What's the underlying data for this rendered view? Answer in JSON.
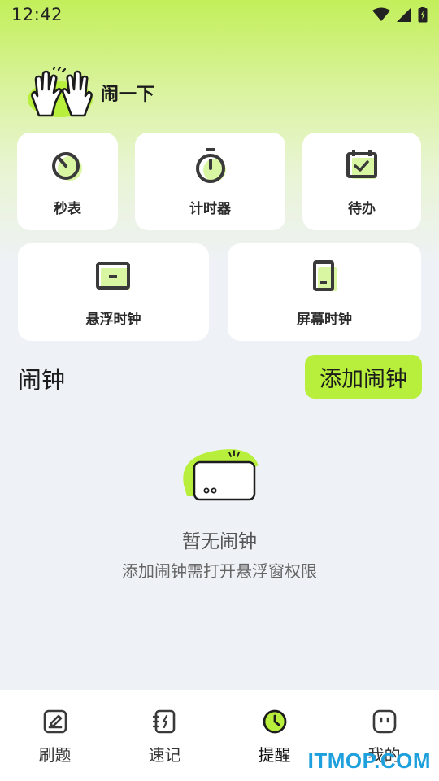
{
  "status_bar": {
    "time": "12:42"
  },
  "brand": {
    "name": "闹一下"
  },
  "tools": [
    {
      "label": "秒表",
      "icon": "stopwatch-icon"
    },
    {
      "label": "计时器",
      "icon": "timer-icon"
    },
    {
      "label": "待办",
      "icon": "todo-icon"
    },
    {
      "label": "悬浮时钟",
      "icon": "floating-clock-icon"
    },
    {
      "label": "屏幕时钟",
      "icon": "screen-clock-icon"
    }
  ],
  "alarm_section": {
    "title": "闹钟",
    "add_button": "添加闹钟",
    "empty_title": "暂无闹钟",
    "empty_subtitle": "添加闹钟需打开悬浮窗权限"
  },
  "bottom_nav": [
    {
      "label": "刷题",
      "icon": "edit-icon",
      "active": false
    },
    {
      "label": "速记",
      "icon": "notebook-icon",
      "active": false
    },
    {
      "label": "提醒",
      "icon": "clock-icon",
      "active": true
    },
    {
      "label": "我的",
      "icon": "profile-icon",
      "active": false
    }
  ],
  "watermark": "ITMOP.COM",
  "colors": {
    "accent": "#b8ef3c",
    "icon_dark": "#3a3a3a",
    "background": "#eef2f6"
  }
}
